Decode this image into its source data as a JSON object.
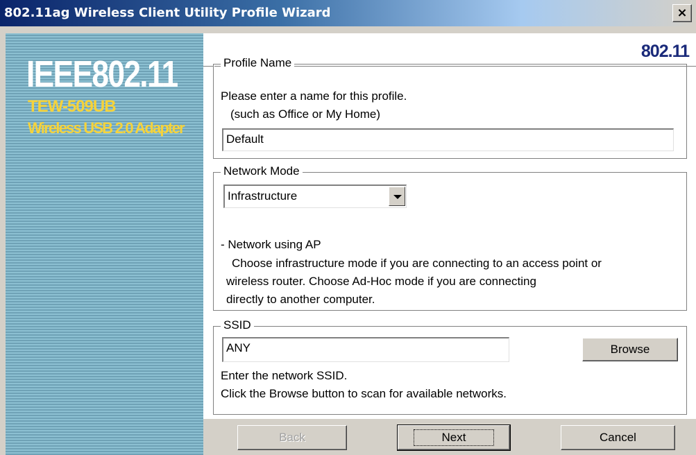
{
  "window": {
    "title": "802.11ag Wireless Client Utility Profile Wizard",
    "close_glyph": "×"
  },
  "banner": {
    "title": "IEEE802.11",
    "model": "TEW-509UB",
    "description": "Wireless USB 2.0 Adapter"
  },
  "header": {
    "logo": "802.11"
  },
  "profile": {
    "group_label": "Profile Name",
    "instruction": "Please enter a name for this profile.",
    "example": "(such as Office or My Home)",
    "name_value": "Default"
  },
  "network": {
    "group_label": "Network Mode",
    "selected_mode": "Infrastructure",
    "mode_title": "- Network using AP",
    "desc_line1": "Choose infrastructure mode if you are connecting to an access point or",
    "desc_line2": "wireless router. Choose Ad-Hoc mode if you are connecting",
    "desc_line3": "directly to another computer."
  },
  "ssid": {
    "group_label": "SSID",
    "value": "ANY",
    "browse_label": "Browse",
    "help_line1": "Enter the network SSID.",
    "help_line2": "Click the Browse button to scan for available networks."
  },
  "buttons": {
    "back": "Back",
    "next": "Next",
    "cancel": "Cancel"
  }
}
